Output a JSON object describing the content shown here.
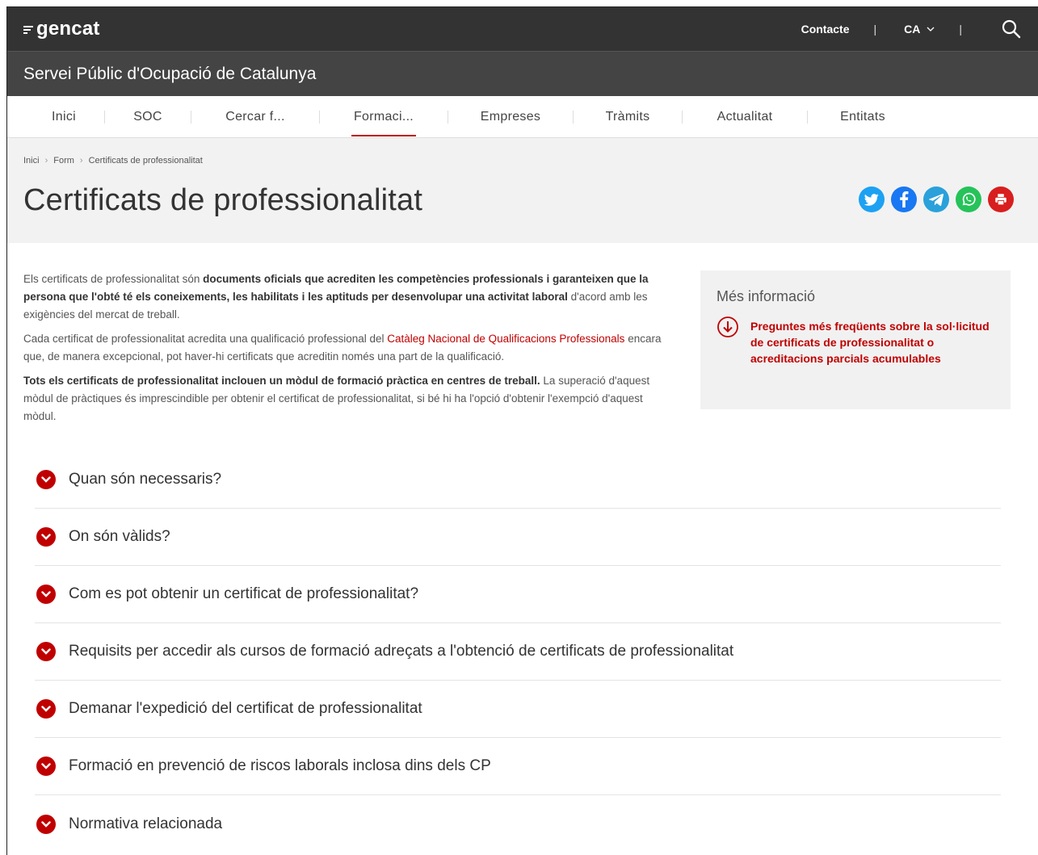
{
  "topbar": {
    "logo": "gencat",
    "contact_label": "Contacte",
    "separator": "|",
    "lang_label": "CA"
  },
  "subbar": {
    "title": "Servei Públic d'Ocupació de Catalunya"
  },
  "nav": {
    "items": [
      {
        "label": "Inici"
      },
      {
        "label": "SOC"
      },
      {
        "label": "Cercar f..."
      },
      {
        "label": "Formaci..."
      },
      {
        "label": "Empreses"
      },
      {
        "label": "Tràmits"
      },
      {
        "label": "Actualitat"
      },
      {
        "label": "Entitats"
      }
    ],
    "active_index": 3
  },
  "breadcrumb": {
    "items": [
      "Inici",
      "Form",
      "Certificats de professionalitat"
    ],
    "separator": "›"
  },
  "page": {
    "title": "Certificats de professionalitat"
  },
  "social": [
    "twitter-icon",
    "facebook-icon",
    "telegram-icon",
    "whatsapp-icon",
    "print-icon"
  ],
  "intro": {
    "p1_a": "Els certificats de professionalitat són ",
    "p1_b": "documents oficials que acrediten les competències professionals i garanteixen que la persona que l'obté té els coneixements, les habilitats i les aptituds per desenvolupar una activitat laboral",
    "p1_c": " d'acord amb les exigències del mercat de treball.",
    "p2_a": "Cada certificat de professionalitat acredita una qualificació professional del ",
    "p2_link": "Catàleg Nacional de Qualificacions Professionals",
    "p2_b": " encara que, de manera excepcional, pot haver-hi certificats que acreditin només una part de la qualificació.",
    "p3_a": "Tots els certificats de professionalitat inclouen un mòdul de formació pràctica en centres de treball.",
    "p3_b": " La superació d'aquest mòdul de pràctiques és imprescindible per obtenir el certificat de professionalitat, si bé hi ha l'opció d'obtenir l'exempció d'aquest mòdul."
  },
  "sidebox": {
    "title": "Més informació",
    "link": "Preguntes més freqüents sobre la sol·licitud de certificats de professionalitat o acreditacions parcials acumulables"
  },
  "accordion": [
    {
      "label": "Quan són necessaris?"
    },
    {
      "label": "On són vàlids?"
    },
    {
      "label": "Com es pot obtenir un certificat de professionalitat?"
    },
    {
      "label": "Requisits per accedir als cursos de formació adreçats a l'obtenció de certificats de professionalitat"
    },
    {
      "label": "Demanar l'expedició del certificat de professionalitat"
    },
    {
      "label": "Formació en prevenció de riscos laborals inclosa dins dels CP"
    },
    {
      "label": "Normativa relacionada"
    }
  ],
  "colors": {
    "accent": "#c00000",
    "topbar": "#333333",
    "subbar": "#444444",
    "twitter": "#1da1f2",
    "facebook": "#1877f2",
    "telegram": "#2aa1da",
    "whatsapp": "#25c35a",
    "print": "#d81e1e"
  }
}
